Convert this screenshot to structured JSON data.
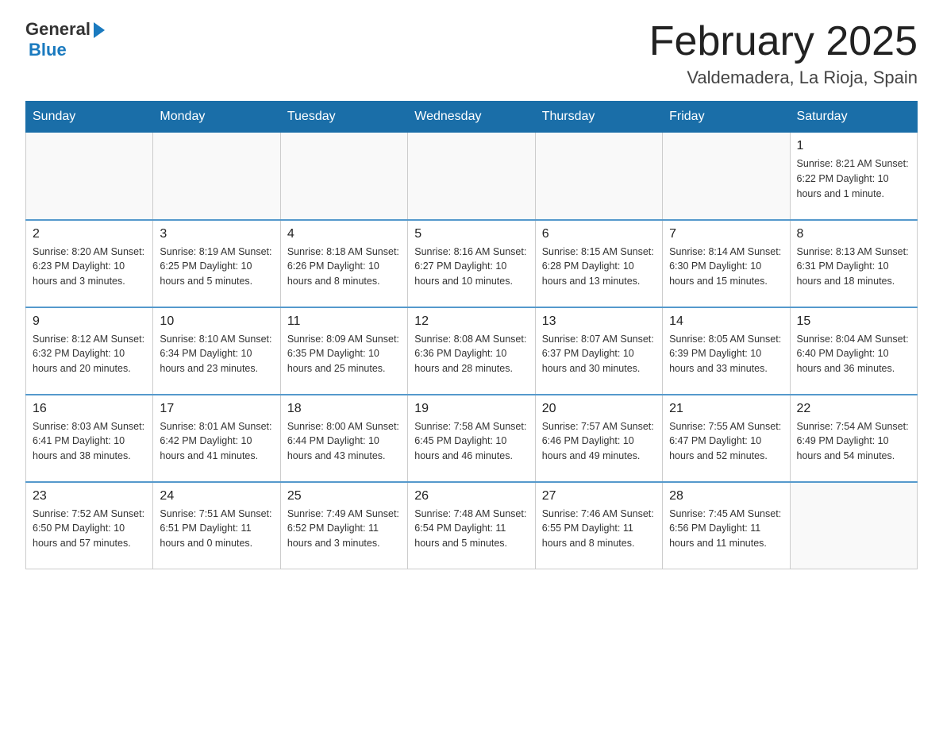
{
  "header": {
    "logo_general": "General",
    "logo_blue": "Blue",
    "title": "February 2025",
    "subtitle": "Valdemadera, La Rioja, Spain"
  },
  "weekdays": [
    "Sunday",
    "Monday",
    "Tuesday",
    "Wednesday",
    "Thursday",
    "Friday",
    "Saturday"
  ],
  "weeks": [
    [
      {
        "day": "",
        "info": ""
      },
      {
        "day": "",
        "info": ""
      },
      {
        "day": "",
        "info": ""
      },
      {
        "day": "",
        "info": ""
      },
      {
        "day": "",
        "info": ""
      },
      {
        "day": "",
        "info": ""
      },
      {
        "day": "1",
        "info": "Sunrise: 8:21 AM\nSunset: 6:22 PM\nDaylight: 10 hours and 1 minute."
      }
    ],
    [
      {
        "day": "2",
        "info": "Sunrise: 8:20 AM\nSunset: 6:23 PM\nDaylight: 10 hours and 3 minutes."
      },
      {
        "day": "3",
        "info": "Sunrise: 8:19 AM\nSunset: 6:25 PM\nDaylight: 10 hours and 5 minutes."
      },
      {
        "day": "4",
        "info": "Sunrise: 8:18 AM\nSunset: 6:26 PM\nDaylight: 10 hours and 8 minutes."
      },
      {
        "day": "5",
        "info": "Sunrise: 8:16 AM\nSunset: 6:27 PM\nDaylight: 10 hours and 10 minutes."
      },
      {
        "day": "6",
        "info": "Sunrise: 8:15 AM\nSunset: 6:28 PM\nDaylight: 10 hours and 13 minutes."
      },
      {
        "day": "7",
        "info": "Sunrise: 8:14 AM\nSunset: 6:30 PM\nDaylight: 10 hours and 15 minutes."
      },
      {
        "day": "8",
        "info": "Sunrise: 8:13 AM\nSunset: 6:31 PM\nDaylight: 10 hours and 18 minutes."
      }
    ],
    [
      {
        "day": "9",
        "info": "Sunrise: 8:12 AM\nSunset: 6:32 PM\nDaylight: 10 hours and 20 minutes."
      },
      {
        "day": "10",
        "info": "Sunrise: 8:10 AM\nSunset: 6:34 PM\nDaylight: 10 hours and 23 minutes."
      },
      {
        "day": "11",
        "info": "Sunrise: 8:09 AM\nSunset: 6:35 PM\nDaylight: 10 hours and 25 minutes."
      },
      {
        "day": "12",
        "info": "Sunrise: 8:08 AM\nSunset: 6:36 PM\nDaylight: 10 hours and 28 minutes."
      },
      {
        "day": "13",
        "info": "Sunrise: 8:07 AM\nSunset: 6:37 PM\nDaylight: 10 hours and 30 minutes."
      },
      {
        "day": "14",
        "info": "Sunrise: 8:05 AM\nSunset: 6:39 PM\nDaylight: 10 hours and 33 minutes."
      },
      {
        "day": "15",
        "info": "Sunrise: 8:04 AM\nSunset: 6:40 PM\nDaylight: 10 hours and 36 minutes."
      }
    ],
    [
      {
        "day": "16",
        "info": "Sunrise: 8:03 AM\nSunset: 6:41 PM\nDaylight: 10 hours and 38 minutes."
      },
      {
        "day": "17",
        "info": "Sunrise: 8:01 AM\nSunset: 6:42 PM\nDaylight: 10 hours and 41 minutes."
      },
      {
        "day": "18",
        "info": "Sunrise: 8:00 AM\nSunset: 6:44 PM\nDaylight: 10 hours and 43 minutes."
      },
      {
        "day": "19",
        "info": "Sunrise: 7:58 AM\nSunset: 6:45 PM\nDaylight: 10 hours and 46 minutes."
      },
      {
        "day": "20",
        "info": "Sunrise: 7:57 AM\nSunset: 6:46 PM\nDaylight: 10 hours and 49 minutes."
      },
      {
        "day": "21",
        "info": "Sunrise: 7:55 AM\nSunset: 6:47 PM\nDaylight: 10 hours and 52 minutes."
      },
      {
        "day": "22",
        "info": "Sunrise: 7:54 AM\nSunset: 6:49 PM\nDaylight: 10 hours and 54 minutes."
      }
    ],
    [
      {
        "day": "23",
        "info": "Sunrise: 7:52 AM\nSunset: 6:50 PM\nDaylight: 10 hours and 57 minutes."
      },
      {
        "day": "24",
        "info": "Sunrise: 7:51 AM\nSunset: 6:51 PM\nDaylight: 11 hours and 0 minutes."
      },
      {
        "day": "25",
        "info": "Sunrise: 7:49 AM\nSunset: 6:52 PM\nDaylight: 11 hours and 3 minutes."
      },
      {
        "day": "26",
        "info": "Sunrise: 7:48 AM\nSunset: 6:54 PM\nDaylight: 11 hours and 5 minutes."
      },
      {
        "day": "27",
        "info": "Sunrise: 7:46 AM\nSunset: 6:55 PM\nDaylight: 11 hours and 8 minutes."
      },
      {
        "day": "28",
        "info": "Sunrise: 7:45 AM\nSunset: 6:56 PM\nDaylight: 11 hours and 11 minutes."
      },
      {
        "day": "",
        "info": ""
      }
    ]
  ]
}
